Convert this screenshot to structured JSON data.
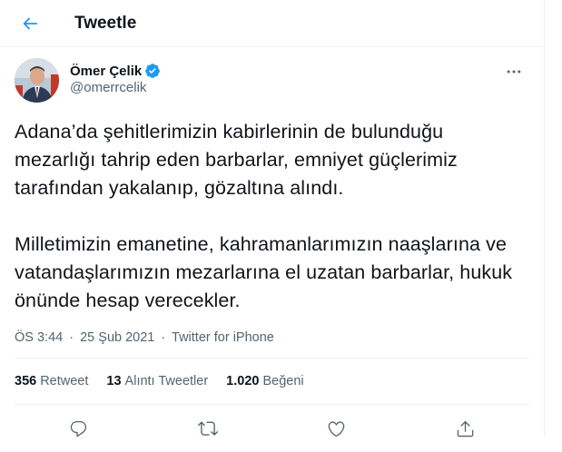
{
  "header": {
    "back_icon": "arrow-left-icon",
    "title": "Tweetle"
  },
  "author": {
    "display_name": "Ömer Çelik",
    "handle": "@omerrcelik",
    "verified_icon": "verified-badge-icon",
    "more_icon": "more-horizontal-icon"
  },
  "tweet": {
    "paragraphs": [
      "Adana’da şehitlerimizin kabirlerinin de bulunduğu mezarlığı tahrip eden barbarlar, emniyet güçlerimiz tarafından yakalanıp, gözaltına alındı.",
      "Milletimizin emanetine, kahramanlarımızın naaşlarına ve vatandaşlarımızın mezarlarına el uzatan barbarlar, hukuk önünde hesap verecekler."
    ]
  },
  "meta": {
    "time": "ÖS 3:44",
    "separator": "·",
    "date": "25 Şub 2021",
    "source": "Twitter for iPhone"
  },
  "stats": {
    "retweets_count": "356",
    "retweets_label": "Retweet",
    "quotes_count": "13",
    "quotes_label": "Alıntı Tweetler",
    "likes_count": "1.020",
    "likes_label": "Beğeni"
  },
  "actions": {
    "reply_icon": "reply-icon",
    "retweet_icon": "retweet-icon",
    "like_icon": "like-icon",
    "share_icon": "share-icon"
  },
  "colors": {
    "accent": "#1d9bf0",
    "text_primary": "#0f1419",
    "text_secondary": "#536471",
    "divider": "#eff3f4"
  }
}
